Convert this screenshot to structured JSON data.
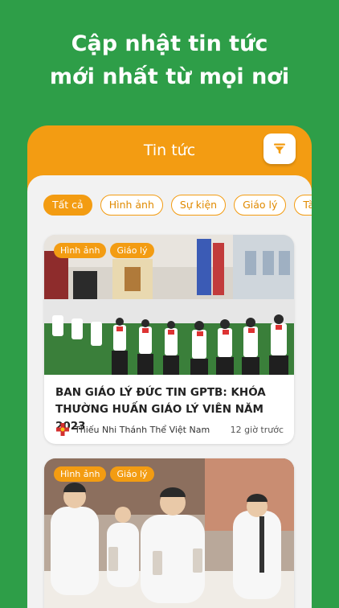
{
  "headline": {
    "line1": "Cập nhật tin tức",
    "line2": "mới nhất từ mọi nơi"
  },
  "app": {
    "title": "Tin tức",
    "filter_icon": "filter-icon"
  },
  "categories": [
    {
      "label": "Tất cả",
      "active": true
    },
    {
      "label": "Hình ảnh",
      "active": false
    },
    {
      "label": "Sự kiện",
      "active": false
    },
    {
      "label": "Giáo lý",
      "active": false
    },
    {
      "label": "Tài liệu",
      "active": false
    }
  ],
  "articles": [
    {
      "tags": [
        "Hình ảnh",
        "Giáo lý"
      ],
      "title": "BAN GIÁO LÝ ĐỨC TIN GPTB: KHÓA THƯỜNG HUẤN GIÁO LÝ VIÊN NĂM 2023",
      "source": "Thiếu Nhi Thánh Thể Việt Nam",
      "time": "12 giờ trước"
    },
    {
      "tags": [
        "Hình ảnh",
        "Giáo lý"
      ]
    }
  ],
  "colors": {
    "brand_green": "#2e9e48",
    "accent_orange": "#f39c12"
  }
}
